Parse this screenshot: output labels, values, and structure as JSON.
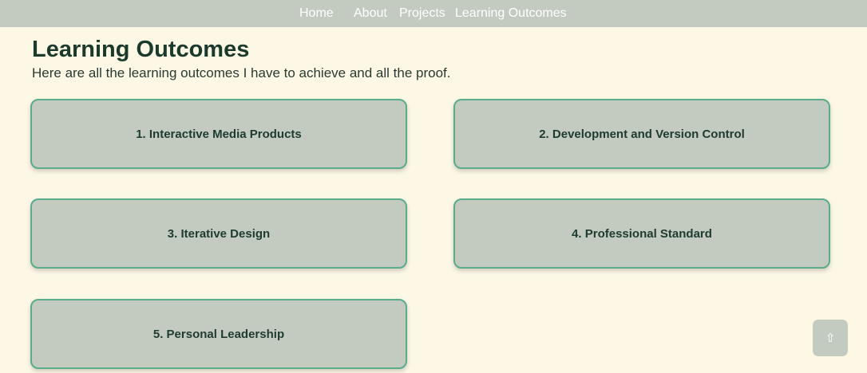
{
  "nav": {
    "items": [
      {
        "label": "Home"
      },
      {
        "label": "About"
      },
      {
        "label": "Projects"
      },
      {
        "label": "Learning Outcomes"
      }
    ]
  },
  "header": {
    "title": "Learning Outcomes",
    "subtitle": "Here are all the learning outcomes I have to achieve and all the proof."
  },
  "outcomes": [
    {
      "label": "1. Interactive Media Products"
    },
    {
      "label": "2. Development and Version Control"
    },
    {
      "label": "3. Iterative Design"
    },
    {
      "label": "4. Professional Standard"
    },
    {
      "label": "5. Personal Leadership"
    }
  ],
  "scroll_top": {
    "icon": "arrow-up-icon",
    "glyph": "⇧"
  }
}
